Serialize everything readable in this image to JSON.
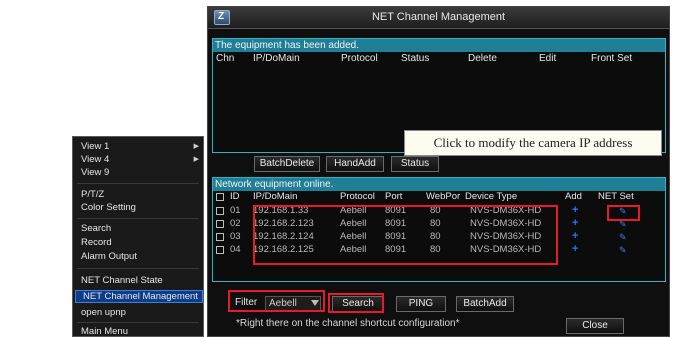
{
  "context_menu": {
    "items": [
      {
        "label": "View 1",
        "submenu": true
      },
      {
        "label": "View 4",
        "submenu": true
      },
      {
        "label": "View 9",
        "submenu": false
      },
      {
        "label": "P/T/Z"
      },
      {
        "label": "Color Setting"
      },
      {
        "label": "Search"
      },
      {
        "label": "Record"
      },
      {
        "label": "Alarm Output"
      },
      {
        "label": "NET Channel State"
      },
      {
        "label": "NET Channel Management",
        "selected": true
      },
      {
        "label": "open upnp"
      },
      {
        "label": "Main Menu"
      }
    ]
  },
  "window": {
    "title": "NET Channel Management",
    "added_section": {
      "heading": "The equipment has been added.",
      "columns": [
        "Chn",
        "IP/DoMain",
        "Protocol",
        "Status",
        "Delete",
        "Edit",
        "Front Set"
      ]
    },
    "buttons": {
      "batch_delete": "BatchDelete",
      "hand_add": "HandAdd",
      "status": "Status"
    },
    "online_section": {
      "heading": "Network equipment online.",
      "columns": [
        "ID",
        "IP/DoMain",
        "Protocol",
        "Port",
        "WebPor",
        "Device Type",
        "Add",
        "NET Set"
      ],
      "rows": [
        {
          "id": "01",
          "ip": "192.168.1.33",
          "protocol": "Aebell",
          "port": "8091",
          "webport": "80",
          "device_type": "NVS-DM36X-HD"
        },
        {
          "id": "02",
          "ip": "192.168.2.123",
          "protocol": "Aebell",
          "port": "8091",
          "webport": "80",
          "device_type": "NVS-DM36X-HD"
        },
        {
          "id": "03",
          "ip": "192.168.2.124",
          "protocol": "Aebell",
          "port": "8091",
          "webport": "80",
          "device_type": "NVS-DM36X-HD"
        },
        {
          "id": "04",
          "ip": "192.168.2.125",
          "protocol": "Aebell",
          "port": "8091",
          "webport": "80",
          "device_type": "NVS-DM36X-HD"
        }
      ]
    },
    "filter": {
      "label": "Filter",
      "value": "Aebell"
    },
    "bottom_buttons": {
      "search": "Search",
      "ping": "PING",
      "batch_add": "BatchAdd",
      "close": "Close"
    },
    "footer_note": "*Right there on the channel shortcut configuration*"
  },
  "callout": {
    "text": "Click to modify the camera IP address"
  },
  "colors": {
    "panel_border": "#2fb3c8",
    "panel_header": "#1f7f96",
    "highlight": "#e8192b",
    "selection": "#0d3c88",
    "icon_blue": "#2a74ff"
  }
}
